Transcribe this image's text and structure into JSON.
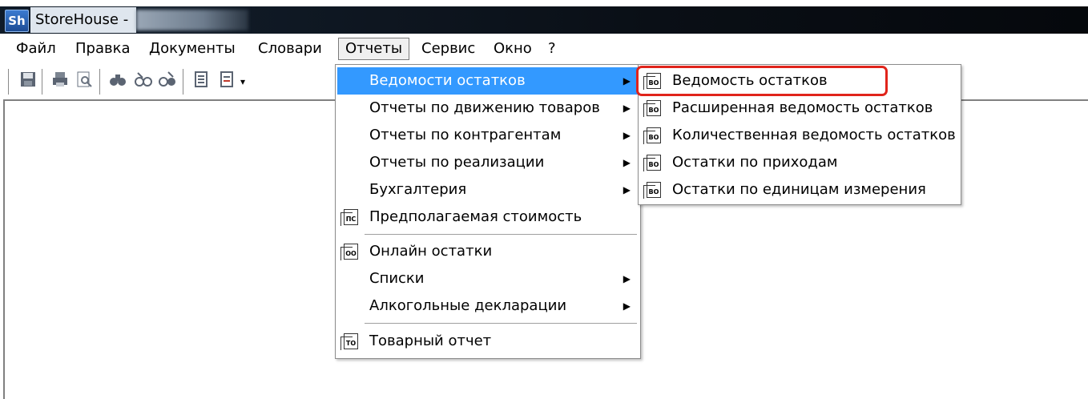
{
  "window": {
    "title": "StoreHouse -",
    "icon": "storehouse-app-icon",
    "icon_text": "Sh"
  },
  "menubar": {
    "items": [
      {
        "label": "Файл"
      },
      {
        "label": "Правка"
      },
      {
        "label": "Документы"
      },
      {
        "label": "Словари"
      },
      {
        "label": "Отчеты",
        "active": true
      },
      {
        "label": "Сервис"
      },
      {
        "label": "Окно"
      },
      {
        "label": "?"
      }
    ]
  },
  "toolbar": {
    "icons": [
      "save-icon",
      "print-icon",
      "print-preview-icon",
      "find-icon",
      "find-next-icon",
      "find-replace-icon",
      "report-icon",
      "report-list-icon",
      "dropdown-icon"
    ]
  },
  "reports_menu": {
    "items": [
      {
        "label": "Ведомости остатков",
        "submenu": true,
        "highlighted": true
      },
      {
        "label": "Отчеты по движению товаров",
        "submenu": true
      },
      {
        "label": "Отчеты по контрагентам",
        "submenu": true
      },
      {
        "label": "Отчеты по реализации",
        "submenu": true
      },
      {
        "label": "Бухгалтерия",
        "submenu": true
      },
      {
        "label": "Предполагаемая стоимость",
        "icon": "report-pc-icon",
        "icon_text": "ПС"
      },
      {
        "label": "Онлайн остатки",
        "icon": "report-oo-icon",
        "icon_text": "ОО"
      },
      {
        "label": "Списки",
        "submenu": true
      },
      {
        "label": "Алкогольные декларации",
        "submenu": true
      },
      {
        "label": "Товарный отчет",
        "icon": "report-to-icon",
        "icon_text": "ТО"
      }
    ],
    "arrow": "▶"
  },
  "balances_submenu": {
    "items": [
      {
        "label": "Ведомость остатков",
        "icon_text": "ВО",
        "annotated": true
      },
      {
        "label": "Расширенная ведомость остатков",
        "icon_text": "ВО"
      },
      {
        "label": "Количественная ведомость остатков",
        "icon_text": "ВО"
      },
      {
        "label": "Остатки по приходам",
        "icon_text": "ВО"
      },
      {
        "label": "Остатки по единицам измерения",
        "icon_text": "ВО"
      }
    ]
  },
  "colors": {
    "highlight": "#3399ff",
    "annotation": "#e0241b",
    "titlebar": "#101a26"
  }
}
